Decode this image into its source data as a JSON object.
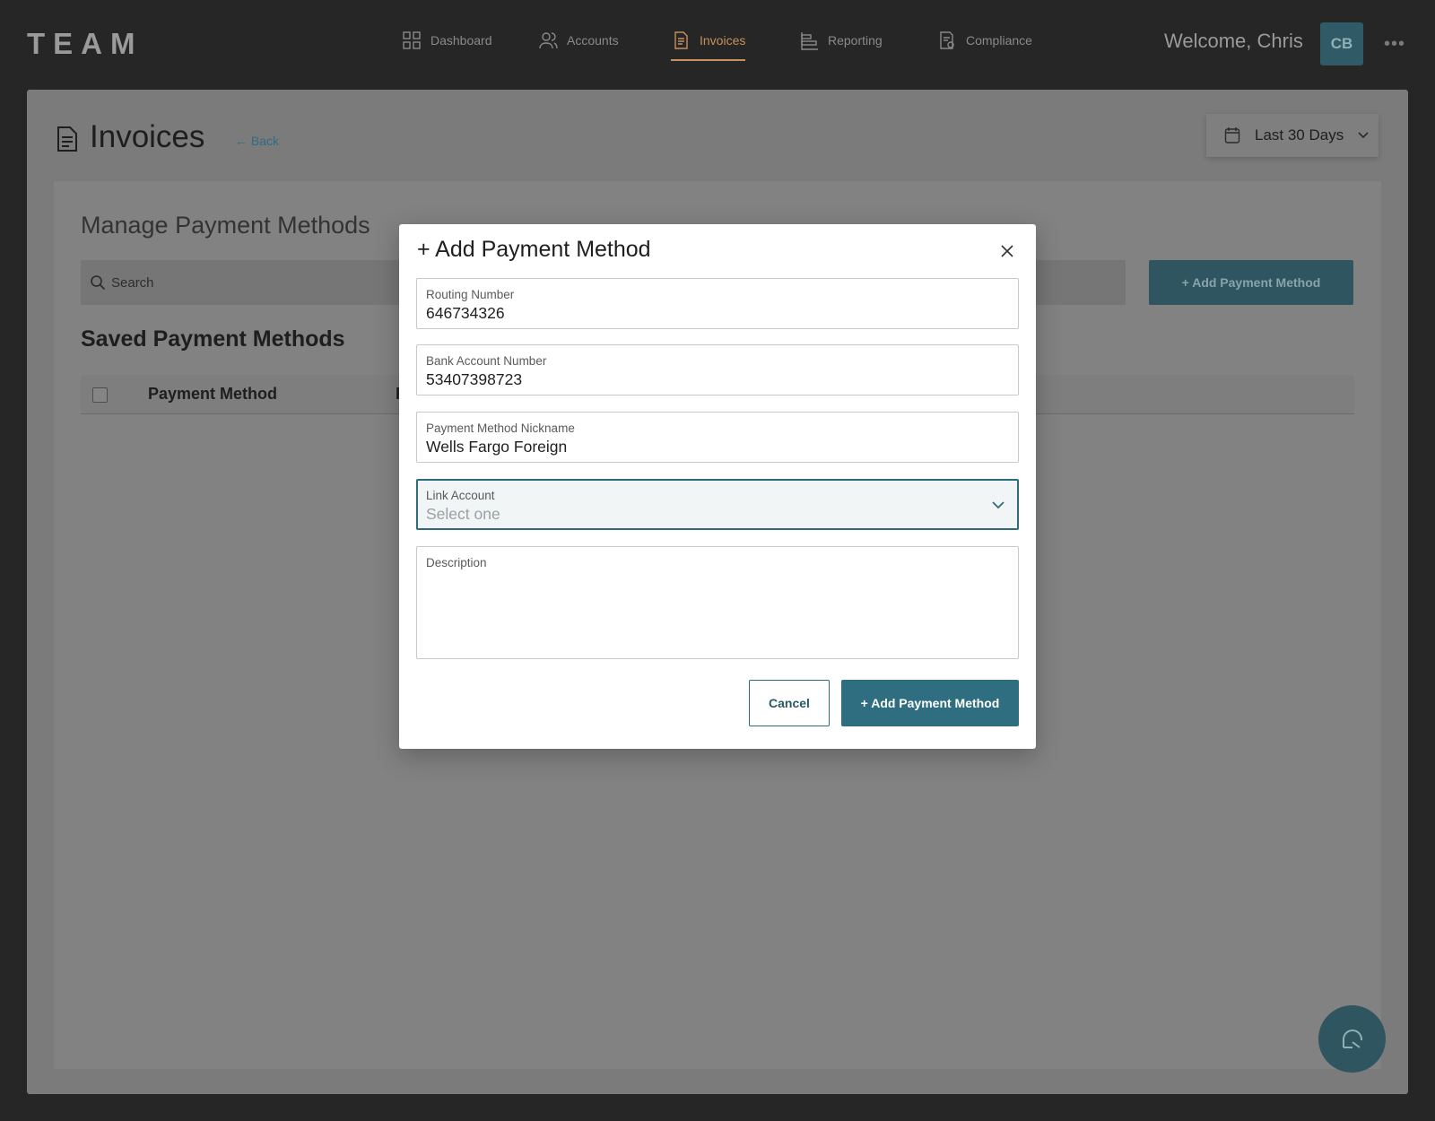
{
  "app": {
    "logo": "TEAM"
  },
  "nav": {
    "items": [
      {
        "label": "Dashboard",
        "icon": "grid-icon"
      },
      {
        "label": "Accounts",
        "icon": "users-icon"
      },
      {
        "label": "Invoices",
        "icon": "document-icon",
        "active": true
      },
      {
        "label": "Reporting",
        "icon": "bar-chart-icon"
      },
      {
        "label": "Compliance",
        "icon": "compliance-icon"
      }
    ]
  },
  "user": {
    "welcome": "Welcome, Chris",
    "initials": "CB",
    "more": "•••"
  },
  "page": {
    "title": "Invoices",
    "back": "← Back",
    "date_filter": "Last 30 Days"
  },
  "panel": {
    "title": "Manage Payment Methods",
    "search_placeholder": "Search",
    "add_button": "+ Add Payment Method",
    "saved_title": "Saved Payment Methods",
    "columns": [
      "Payment Method",
      "P"
    ]
  },
  "modal": {
    "title": "+ Add Payment Method",
    "fields": {
      "routing": {
        "label": "Routing Number",
        "value": "646734326"
      },
      "account": {
        "label": "Bank Account Number",
        "value": "53407398723"
      },
      "nickname": {
        "label": "Payment Method Nickname",
        "value": "Wells Fargo Foreign"
      },
      "link": {
        "label": "Link Account",
        "placeholder": "Select one"
      },
      "description": {
        "label": "Description",
        "value": ""
      }
    },
    "cancel": "Cancel",
    "submit": "+ Add Payment Method"
  },
  "colors": {
    "accent": "#2e6e80",
    "active_nav": "#c6915a",
    "overlay_bg": "#7b7b7b"
  }
}
